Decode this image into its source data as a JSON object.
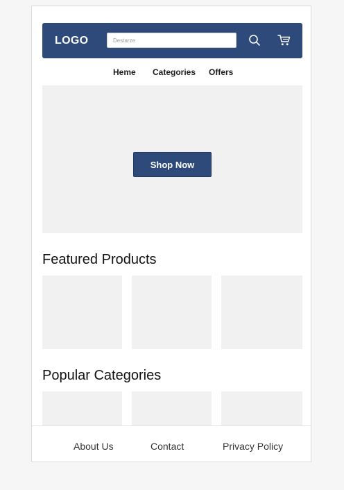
{
  "header": {
    "logo": "LOGO",
    "search_placeholder": "Destarze",
    "search_icon": "search-icon",
    "cart_icon": "cart-icon",
    "background_color": "#2e4a7a"
  },
  "nav": {
    "items": [
      {
        "label": "Heme"
      },
      {
        "label": "Categories"
      },
      {
        "label": "Offers"
      }
    ]
  },
  "hero": {
    "cta_label": "Shop Now"
  },
  "featured": {
    "title": "Featured Products"
  },
  "popular": {
    "title": "Popular Categories"
  },
  "footer": {
    "links": [
      {
        "label": "About Us"
      },
      {
        "label": "Contact"
      },
      {
        "label": "Privacy Policy"
      }
    ]
  }
}
